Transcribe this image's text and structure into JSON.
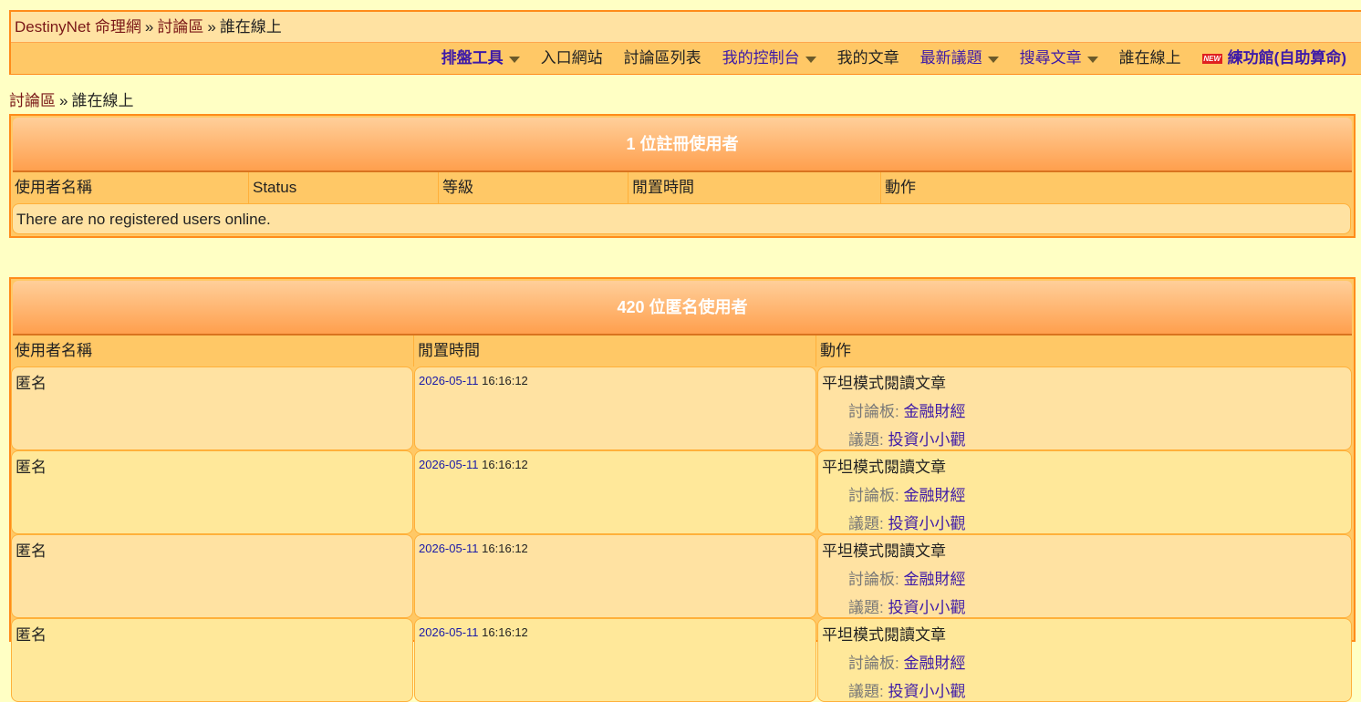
{
  "header": {
    "breadcrumb": {
      "home": "DestinyNet 命理網",
      "forum": "討論區",
      "current": "誰在線上",
      "separator": "»"
    },
    "nav": [
      {
        "label": "排盤工具",
        "dropdown": true,
        "style": "purple-bold"
      },
      {
        "label": "入口網站",
        "dropdown": false,
        "style": "plain"
      },
      {
        "label": "討論區列表",
        "dropdown": false,
        "style": "plain"
      },
      {
        "label": "我的控制台",
        "dropdown": true,
        "style": "purple"
      },
      {
        "label": "我的文章",
        "dropdown": false,
        "style": "plain"
      },
      {
        "label": "最新議題",
        "dropdown": true,
        "style": "purple"
      },
      {
        "label": "搜尋文章",
        "dropdown": true,
        "style": "purple"
      },
      {
        "label": "誰在線上",
        "dropdown": false,
        "style": "plain"
      },
      {
        "label": "練功館(自助算命)",
        "dropdown": false,
        "style": "purple-bold",
        "badge": "NEW"
      }
    ]
  },
  "page_breadcrumb": {
    "forum": "討論區",
    "separator": "»",
    "current": "誰在線上"
  },
  "registered": {
    "title": "1 位註冊使用者",
    "columns": [
      "使用者名稱",
      "Status",
      "等級",
      "閒置時間",
      "動作"
    ],
    "empty_message": "There are no registered users online."
  },
  "anonymous": {
    "title": "420 位匿名使用者",
    "columns": [
      "使用者名稱",
      "閒置時間",
      "動作"
    ],
    "rows": [
      {
        "name": "匿名",
        "date": "2026-05-11",
        "time": "16:16:12",
        "action": "平坦模式閱讀文章",
        "board_label": "討論板:",
        "board": "金融財經",
        "topic_label": "議題:",
        "topic": "投資小小觀"
      },
      {
        "name": "匿名",
        "date": "2026-05-11",
        "time": "16:16:12",
        "action": "平坦模式閱讀文章",
        "board_label": "討論板:",
        "board": "金融財經",
        "topic_label": "議題:",
        "topic": "投資小小觀"
      },
      {
        "name": "匿名",
        "date": "2026-05-11",
        "time": "16:16:12",
        "action": "平坦模式閱讀文章",
        "board_label": "討論板:",
        "board": "金融財經",
        "topic_label": "議題:",
        "topic": "投資小小觀"
      },
      {
        "name": "匿名",
        "date": "2026-05-11",
        "time": "16:16:12",
        "action": "平坦模式閱讀文章",
        "board_label": "討論板:",
        "board": "金融財經",
        "topic_label": "議題:",
        "topic": "投資小小觀"
      }
    ]
  },
  "colors": {
    "page_bg": "#ffffc4",
    "border": "#ff8c1a",
    "header_gradient_top": "#ffcf9a",
    "header_gradient_bottom": "#ff9f4d",
    "link_purple": "#3d1aa8",
    "link_maroon": "#7a1717"
  }
}
